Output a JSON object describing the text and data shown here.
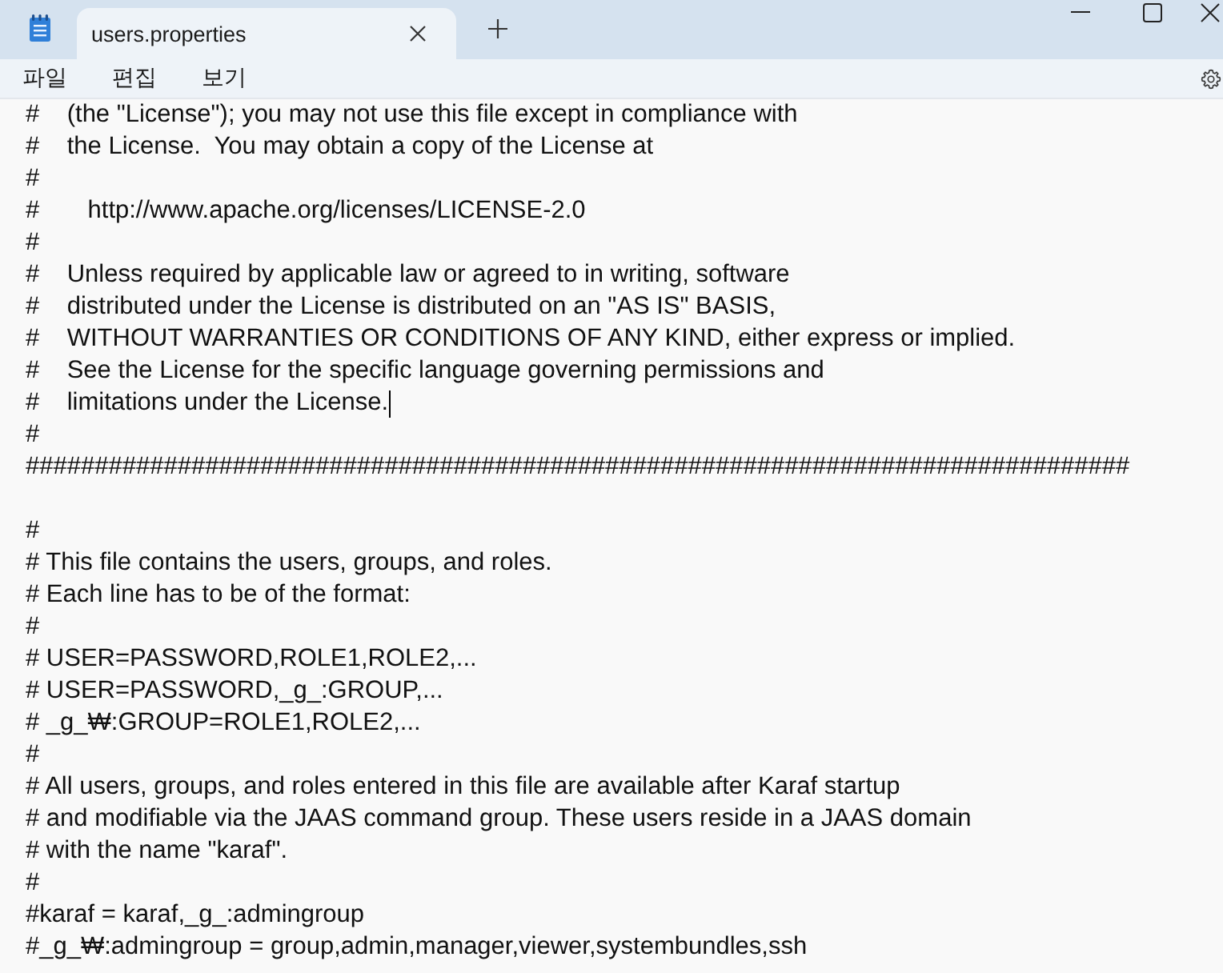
{
  "window": {
    "tabs": [
      {
        "title": "users.properties",
        "selected": true
      }
    ]
  },
  "menu": [
    "파일",
    "편집",
    "보기"
  ],
  "editor": {
    "lines": [
      {
        "text": "#    (the \"License\"); you may not use this file except in compliance with",
        "caret": false
      },
      {
        "text": "#    the License.  You may obtain a copy of the License at",
        "caret": false
      },
      {
        "text": "#",
        "caret": false
      },
      {
        "text": "#       http://www.apache.org/licenses/LICENSE-2.0",
        "caret": false
      },
      {
        "text": "#",
        "caret": false
      },
      {
        "text": "#    Unless required by applicable law or agreed to in writing, software",
        "caret": false
      },
      {
        "text": "#    distributed under the License is distributed on an \"AS IS\" BASIS,",
        "caret": false
      },
      {
        "text": "#    WITHOUT WARRANTIES OR CONDITIONS OF ANY KIND, either express or implied.",
        "caret": false
      },
      {
        "text": "#    See the License for the specific language governing permissions and",
        "caret": false
      },
      {
        "text": "#    limitations under the License.",
        "caret": true
      },
      {
        "text": "#",
        "caret": false
      },
      {
        "text": "################################################################################",
        "caret": false
      },
      {
        "caret": false
      },
      {
        "text": "#",
        "caret": false
      },
      {
        "text": "# This file contains the users, groups, and roles.",
        "caret": false
      },
      {
        "text": "# Each line has to be of the format:",
        "caret": false
      },
      {
        "text": "#",
        "caret": false
      },
      {
        "text": "# USER=PASSWORD,ROLE1,ROLE2,...",
        "caret": false
      },
      {
        "text": "# USER=PASSWORD,_g_:GROUP,...",
        "caret": false
      },
      {
        "text": "# _g_₩:GROUP=ROLE1,ROLE2,...",
        "caret": false
      },
      {
        "text": "#",
        "caret": false
      },
      {
        "text": "# All users, groups, and roles entered in this file are available after Karaf startup",
        "caret": false
      },
      {
        "text": "# and modifiable via the JAAS command group. These users reside in a JAAS domain",
        "caret": false
      },
      {
        "text": "# with the name \"karaf\".",
        "caret": false
      },
      {
        "text": "#",
        "caret": false
      },
      {
        "text": "#karaf = karaf,_g_:admingroup",
        "caret": false
      },
      {
        "text": "#_g_₩:admingroup = group,admin,manager,viewer,systembundles,ssh",
        "caret": false
      }
    ]
  }
}
